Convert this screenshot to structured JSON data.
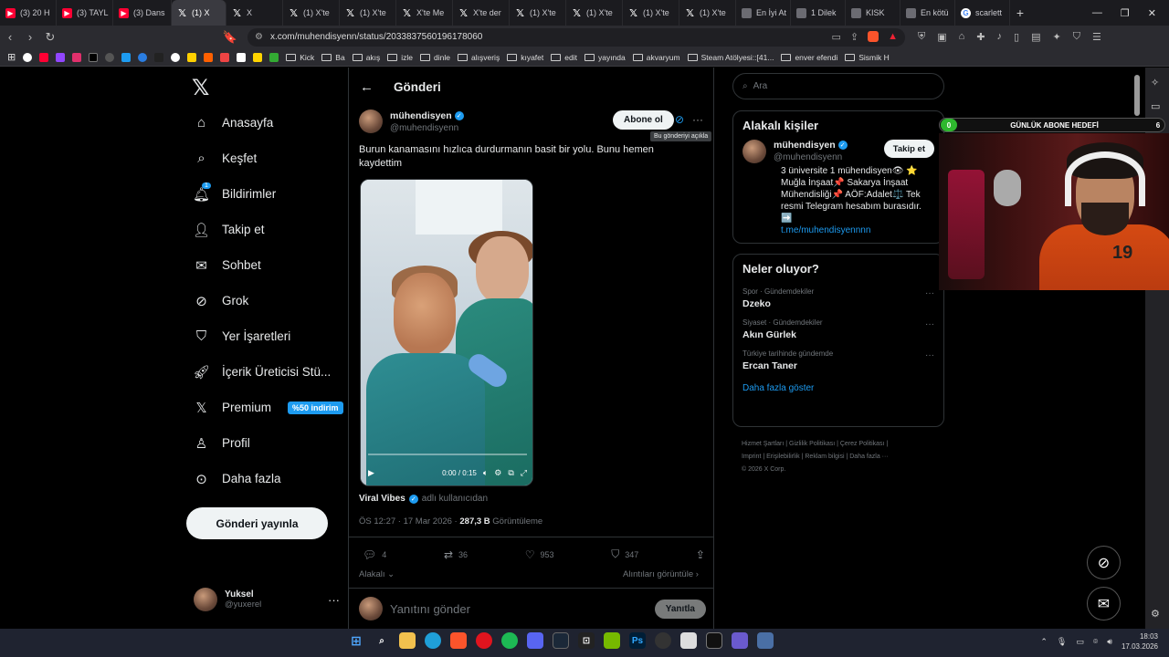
{
  "tabs": [
    {
      "label": "(3) 20 H",
      "icon": "youtube-icon"
    },
    {
      "label": "(3) TAYL",
      "icon": "youtube-icon"
    },
    {
      "label": "(3) Dans",
      "icon": "youtube-icon"
    },
    {
      "label": "(1) X",
      "icon": "x-icon",
      "active": true
    },
    {
      "label": "X",
      "icon": "x-icon"
    },
    {
      "label": "(1) X'te",
      "icon": "x-icon"
    },
    {
      "label": "(1) X'te",
      "icon": "x-icon"
    },
    {
      "label": "X'te Me",
      "icon": "x-icon"
    },
    {
      "label": "X'te der",
      "icon": "x-icon"
    },
    {
      "label": "(1) X'te",
      "icon": "x-icon"
    },
    {
      "label": "(1) X'te",
      "icon": "x-icon"
    },
    {
      "label": "(1) X'te",
      "icon": "x-icon"
    },
    {
      "label": "(1) X'te",
      "icon": "x-icon"
    },
    {
      "label": "En İyi At",
      "icon": "page-icon"
    },
    {
      "label": "1 Dilek",
      "icon": "page-icon"
    },
    {
      "label": "KISK",
      "icon": "page-icon"
    },
    {
      "label": "En kötü",
      "icon": "page-icon"
    },
    {
      "label": "scarlett",
      "icon": "google-icon"
    }
  ],
  "url": "x.com/muhendisyenn/status/2033837560196178060",
  "bookmarks": [
    "Kick",
    "Ba",
    "akış",
    "izle",
    "dinle",
    "alışveriş",
    "kıyafet",
    "edit",
    "yayında",
    "akvaryum",
    "Steam Atölyesi::[41...",
    "enver efendi",
    "Sismik H"
  ],
  "nav": {
    "home": "Anasayfa",
    "explore": "Keşfet",
    "notifications": "Bildirimler",
    "notif_count": "1",
    "follow": "Takip et",
    "chat": "Sohbet",
    "grok": "Grok",
    "bookmarks": "Yer İşaretleri",
    "creator": "İçerik Üreticisi Stü...",
    "premium": "Premium",
    "premium_badge": "%50 indirim",
    "profile": "Profil",
    "more": "Daha fazla",
    "post_button": "Gönderi yayınla"
  },
  "me": {
    "name": "Yuksel",
    "handle": "@yuxerel"
  },
  "post": {
    "header": "Gönderi",
    "author_name": "mühendisyen",
    "author_handle": "@muhendisyenn",
    "subscribe": "Abone ol",
    "tooltip": "Bu gönderiyi açıkla",
    "text": "Burun kanamasını hızlıca durdurmanın basit bir yolu. Bunu hemen kaydettim",
    "video_time": "0:00 / 0:15",
    "via_name": "Viral Vibes",
    "via_suffix": "adlı kullanıcıdan",
    "time": "ÖS 12:27 · 17 Mar 2026 ·",
    "views_count": "287,3 B",
    "views_label": "Görüntüleme",
    "replies": "4",
    "reposts": "36",
    "likes": "953",
    "bookmarks": "347",
    "related": "Alakalı",
    "quotes": "Alıntıları görüntüle",
    "reply_placeholder": "Yanıtını gönder",
    "reply_button": "Yanıtla"
  },
  "search_placeholder": "Ara",
  "related_people": {
    "title": "Alakalı kişiler",
    "name": "mühendisyen",
    "handle": "@muhendisyenn",
    "follow": "Takip et",
    "bio": "3 üniversite 1 mühendisyen👁 ⭐ Muğla İnşaat📌 Sakarya İnşaat Mühendisliği📌 AÖF:Adalet⚖️ Tek resmi Telegram hesabım burasıdır. ➡️",
    "link": "t.me/muhendisyennnn"
  },
  "trends": {
    "title": "Neler oluyor?",
    "items": [
      {
        "category": "Spor · Gündemdekiler",
        "name": "Dzeko"
      },
      {
        "category": "Siyaset · Gündemdekiler",
        "name": "Akın Gürlek"
      },
      {
        "category": "Türkiye tarihinde gündemde",
        "name": "Ercan Taner"
      }
    ],
    "show_more": "Daha fazla göster"
  },
  "footer": {
    "line1": "Hizmet Şartları  |  Gizlilik Politikası  |  Çerez Politikası  |",
    "line2": "Imprint  |  Erişilebilirlik  |  Reklam bilgisi  |  Daha fazla ···",
    "line3": "© 2026 X Corp."
  },
  "goal": {
    "start": "0",
    "label": "GÜNLÜK ABONE HEDEFİ",
    "end": "6"
  },
  "webcam": {
    "jersey_number": "19"
  },
  "clock": {
    "time": "18:03",
    "date": "17.03.2026"
  },
  "colors": {
    "accent": "#1d9bf0",
    "bg": "#000000",
    "border": "#2f3336",
    "muted": "#71767b"
  }
}
